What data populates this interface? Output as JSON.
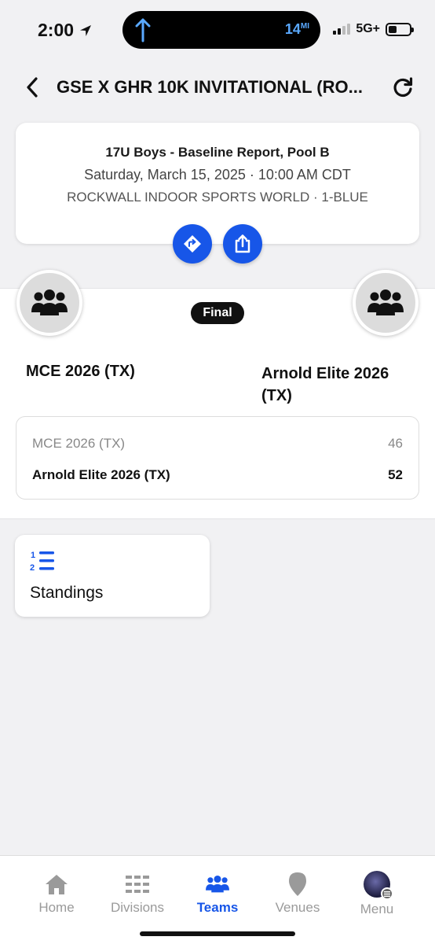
{
  "status_bar": {
    "time": "2:00",
    "distance_value": "14",
    "distance_unit": "MI",
    "network": "5G+"
  },
  "header": {
    "title": "GSE X GHR 10K INVITATIONAL (RO..."
  },
  "game_info": {
    "division": "17U Boys - Baseline Report, Pool B",
    "datetime": "Saturday, March 15, 2025 · 10:00 AM CDT",
    "venue": "ROCKWALL INDOOR SPORTS WORLD · 1-BLUE"
  },
  "game": {
    "status": "Final",
    "home_team": "MCE 2026 (TX)",
    "away_team": "Arnold Elite 2026 (TX)",
    "scores": [
      {
        "team": "MCE 2026 (TX)",
        "score": "46"
      },
      {
        "team": "Arnold Elite 2026 (TX)",
        "score": "52"
      }
    ]
  },
  "standings": {
    "label": "Standings"
  },
  "tabs": [
    {
      "label": "Home",
      "icon": "home-icon",
      "active": false
    },
    {
      "label": "Divisions",
      "icon": "divisions-icon",
      "active": false
    },
    {
      "label": "Teams",
      "icon": "teams-icon",
      "active": true
    },
    {
      "label": "Venues",
      "icon": "venue-pin-icon",
      "active": false
    },
    {
      "label": "Menu",
      "icon": "menu-avatar",
      "active": false
    }
  ],
  "colors": {
    "accent": "#1756e8",
    "background": "#f1f1f3",
    "inactive_tab": "#9a9a9a"
  }
}
